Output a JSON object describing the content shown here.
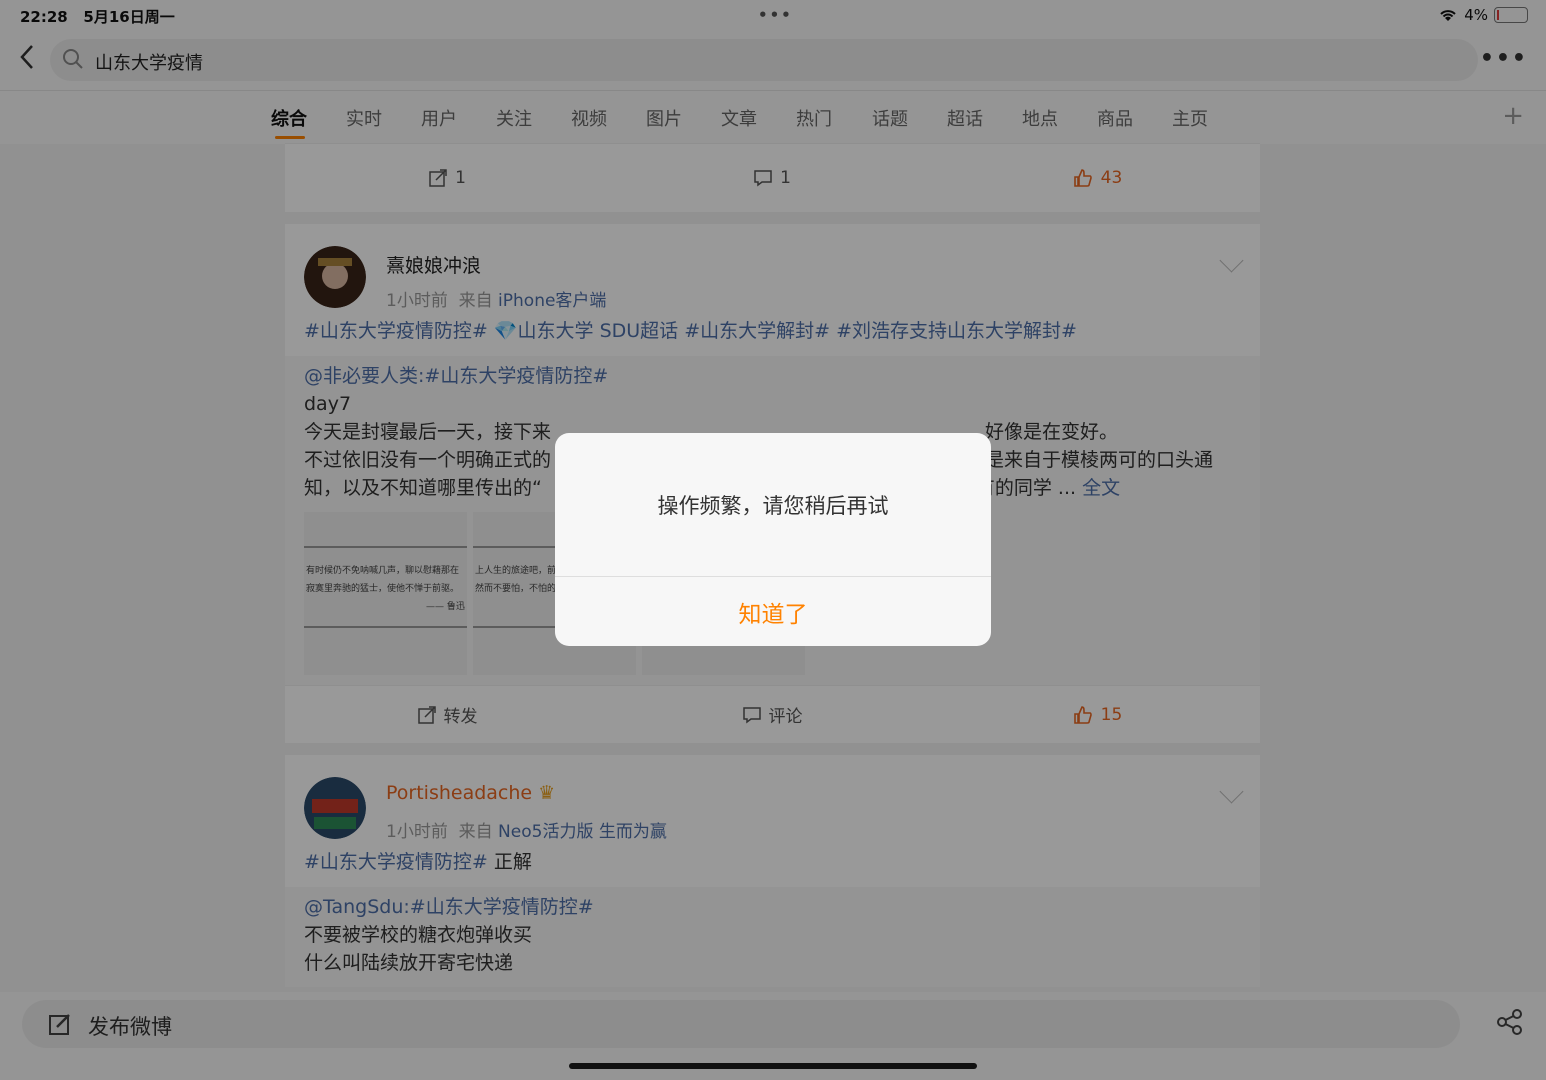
{
  "status": {
    "time": "22:28",
    "date": "5月16日周一",
    "battery": "4%"
  },
  "search": {
    "query": "山东大学疫情"
  },
  "tabs": [
    "综合",
    "实时",
    "用户",
    "关注",
    "视频",
    "图片",
    "文章",
    "热门",
    "话题",
    "超话",
    "地点",
    "商品",
    "主页"
  ],
  "post0": {
    "repost": "1",
    "comment": "1",
    "like": "43"
  },
  "post1": {
    "user": "熹娘娘冲浪",
    "time": "1小时前",
    "from": "来自",
    "source": "iPhone客户端",
    "hashtags": "#山东大学疫情防控# 💎山东大学 SDU超话 #山东大学解封# #刘浩存支持山东大学解封#",
    "rt_head": "@非必要人类:#山东大学疫情防控#",
    "rt_line1": "day7",
    "rt_line2": "今天是封寝最后一天，接下来",
    "rt_line2b": "好像是在变好。",
    "rt_line3": "不过依旧没有一个明确正式的",
    "rt_line3b": "是来自于模棱两可的口头通",
    "rt_line4": "知，以及不知道哪里传出的“",
    "rt_line4b": "有的同学 ...",
    "full_text": "全文",
    "thumb1_line1": "有时候仍不免呐喊几声，聊以慰藉那在",
    "thumb1_line2": "寂寞里奔驰的猛士，使他不惮于前驱。",
    "thumb1_line3": "—— 鲁迅",
    "thumb2_line1": "上人生的旅途吧，前途",
    "thumb2_line2": "然而不要怕，不怕的人",
    "repost_label": "转发",
    "comment_label": "评论",
    "like": "15"
  },
  "post2": {
    "user": "Portisheadache",
    "time": "1小时前",
    "from": "来自",
    "source": "Neo5活力版 生而为赢",
    "hashtag": "#山东大学疫情防控#",
    "text": " 正解",
    "rt_head": "@TangSdu:#山东大学疫情防控#",
    "rt_line1": "不要被学校的糖衣炮弹收买",
    "rt_line2": "什么叫陆续放开寄宅快递"
  },
  "dialog": {
    "message": "操作频繁，请您稍后再试",
    "button": "知道了"
  },
  "compose": {
    "label": "发布微博"
  }
}
